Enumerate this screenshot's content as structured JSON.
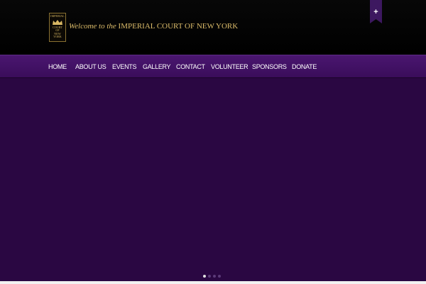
{
  "header": {
    "logo_lines": [
      "IMPERIAL",
      "COURT",
      "OF",
      "NEW YORK"
    ],
    "tagline_script": "Welcome to the",
    "tagline_main": "IMPERIAL COURT OF NEW YORK",
    "toggle_label": "+"
  },
  "nav": {
    "items": [
      {
        "label": "HOME"
      },
      {
        "label": "ABOUT US"
      },
      {
        "label": "EVENTS"
      },
      {
        "label": "GALLERY"
      },
      {
        "label": "CONTACT"
      },
      {
        "label": "VOLUNTEER"
      },
      {
        "label": "SPONSORS"
      },
      {
        "label": "DONATE"
      }
    ]
  },
  "slider": {
    "slide_count": 4,
    "active_slide": 1
  },
  "colors": {
    "header_bg": "#000000",
    "nav_bg": "#3f105f",
    "hero_bg": "#2a0742",
    "gold": "#dcbc6a",
    "ribbon": "#3d1860"
  }
}
